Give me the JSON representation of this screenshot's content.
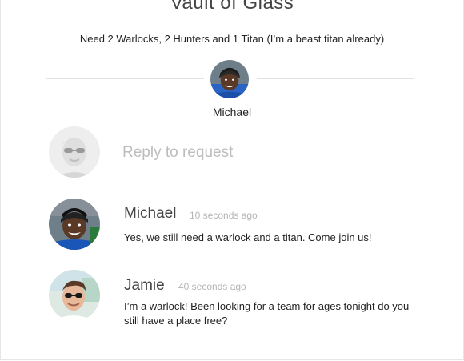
{
  "request": {
    "title": "Vault of Glass",
    "description": "Need 2 Warlocks, 2 Hunters and 1 Titan (I’m a beast titan already)",
    "host_name": "Michael"
  },
  "reply": {
    "placeholder": "Reply to request"
  },
  "comments": [
    {
      "name": "Michael",
      "time": "10 seconds ago",
      "text": "Yes, we still need a warlock and a titan. Come join us!"
    },
    {
      "name": "Jamie",
      "time": "40 seconds ago",
      "text": "I’m a warlock! Been looking for a team for ages tonight do you still have a place free?"
    }
  ]
}
